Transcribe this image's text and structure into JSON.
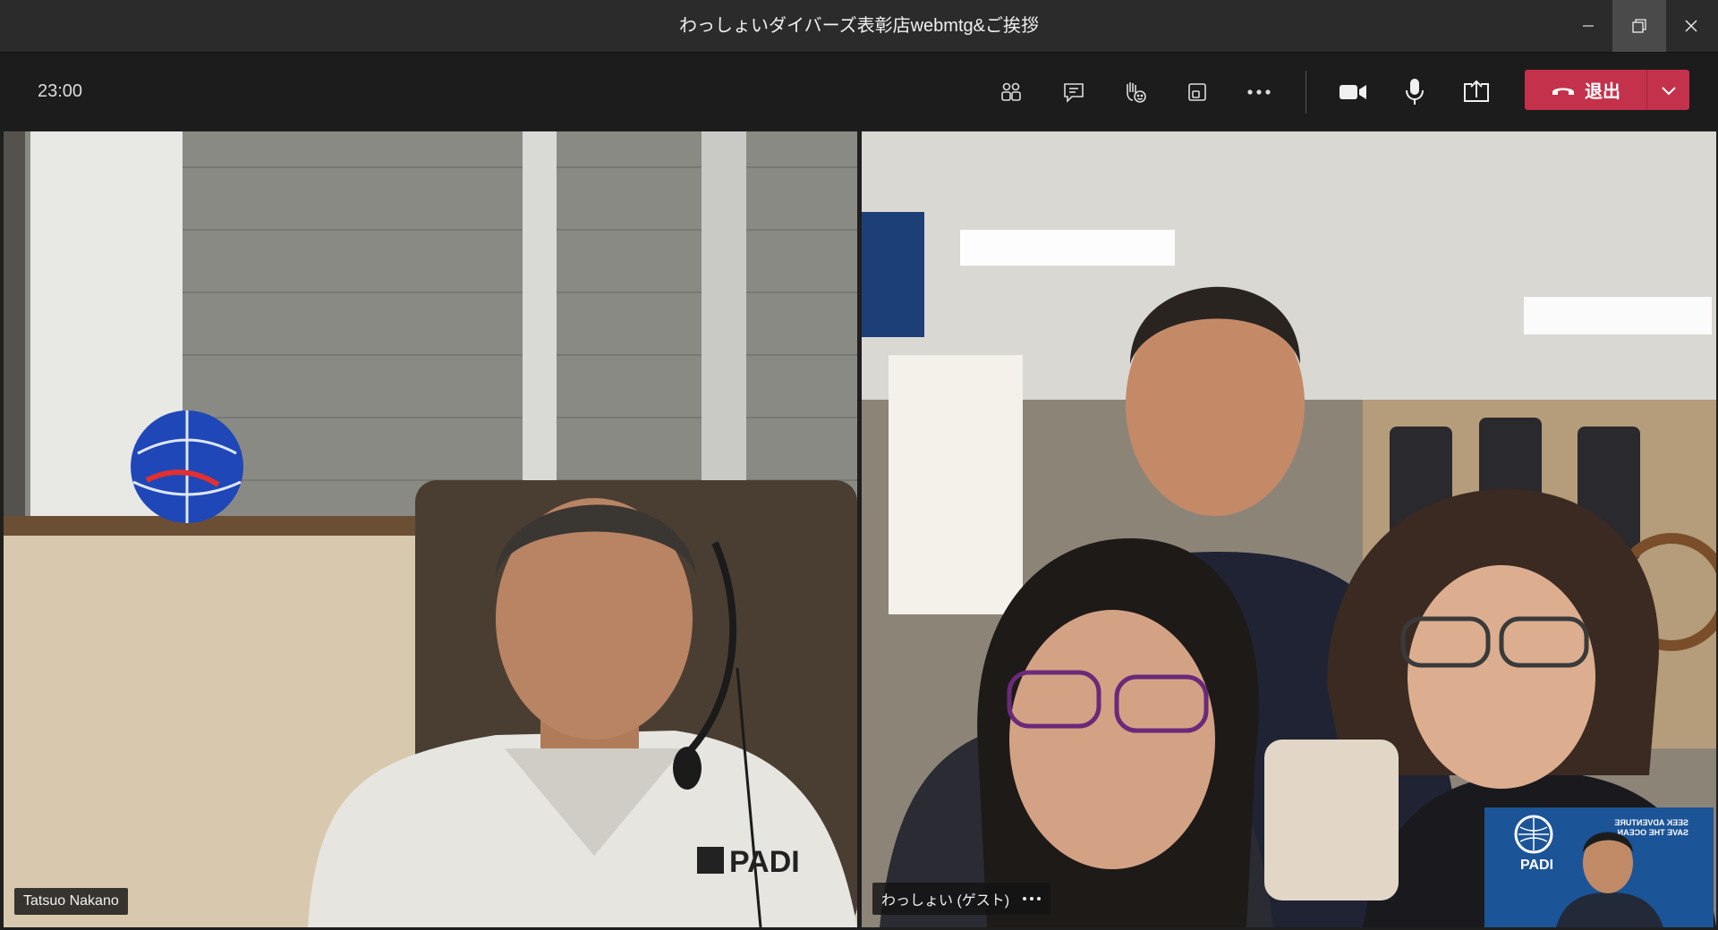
{
  "window": {
    "title": "わっしょいダイバーズ表彰店webmtg&ご挨拶"
  },
  "toolbar": {
    "timer": "23:00",
    "leave_label": "退出"
  },
  "participants": [
    {
      "name": "Tatsuo Nakano"
    },
    {
      "name": "わっしょい (ゲスト)"
    }
  ],
  "colors": {
    "leave_button": "#c4314b",
    "titlebar": "#2b2b2b",
    "toolbar": "#1c1c1c"
  },
  "icons": {
    "people": "people-icon",
    "chat": "chat-icon",
    "raise_hand": "raise-hand-icon",
    "rooms": "breakout-rooms-icon",
    "more": "more-actions-icon",
    "camera": "camera-icon",
    "mic": "microphone-icon",
    "share": "share-screen-icon"
  },
  "selfview_text": {
    "seal": "PADI",
    "line1": "SEEK ADVENTURE",
    "line2": "SAVE THE OCEAN"
  }
}
